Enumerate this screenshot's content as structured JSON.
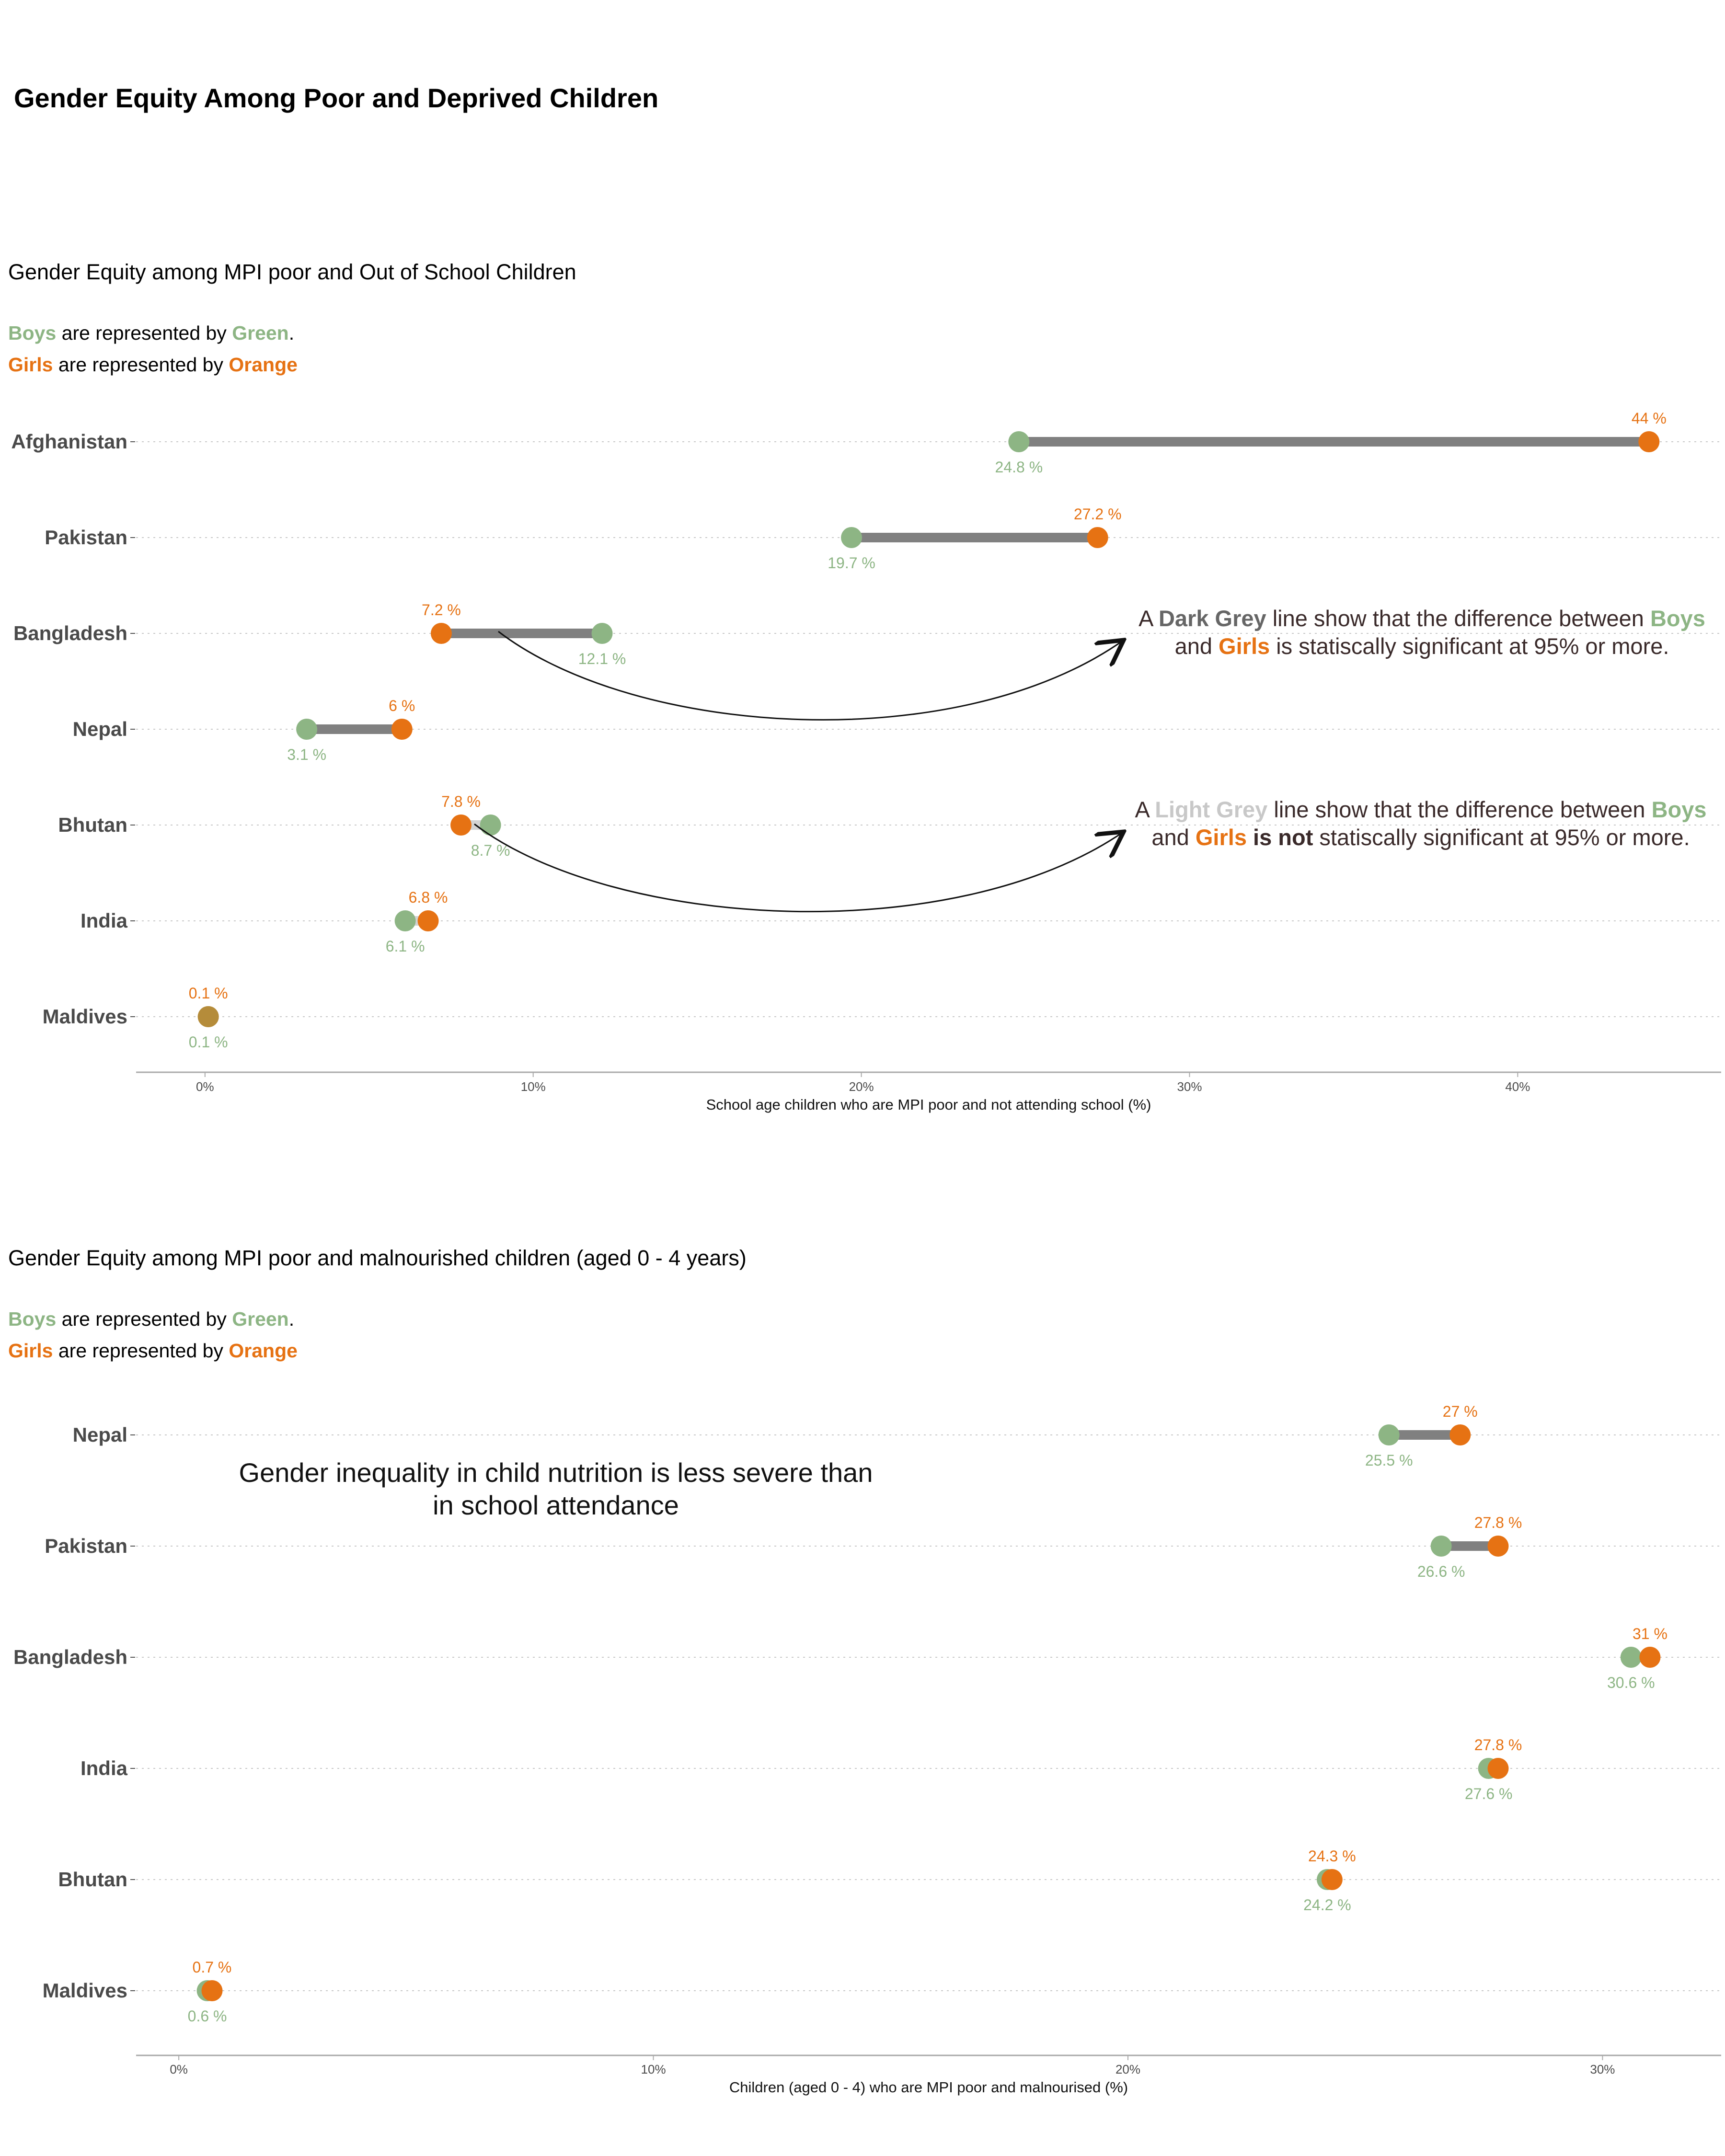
{
  "title": "Gender Equity Among Poor and Deprived Children",
  "legend": {
    "boys_word": "Boys",
    "boys_mid": " are represented by ",
    "green_word": "Green",
    "period": ".",
    "girls_word": "Girls",
    "girls_mid": " are represented by ",
    "orange_word": "Orange"
  },
  "colors": {
    "boys": "#8db584",
    "girls": "#e67213",
    "overlap": "#b58c3a",
    "significant_line": "#808080",
    "not_significant_line": "#d3d3d3",
    "gridline": "#c8c8c8"
  },
  "notes": {
    "dark": {
      "a": "A ",
      "dark_grey": "Dark Grey",
      "line1_rest": " line show that the difference between ",
      "boys": "Boys",
      "and": "and ",
      "girls": "Girls",
      "line2_rest": " is statiscally significant at 95% or more."
    },
    "light": {
      "a": "A ",
      "light_grey": "Light Grey",
      "line1_rest": " line show that the difference between ",
      "boys": "Boys",
      "and": "and ",
      "girls": "Girls",
      "is_not": " is not",
      "line2_rest": " statiscally significant at 95% or more."
    },
    "nutrition": "Gender inequality in child nutrition is less severe than in school attendance"
  },
  "chart_data": [
    {
      "type": "dumbbell",
      "title": "Gender Equity among MPI poor and Out of School Children",
      "xlabel": "School age children who are MPI poor and not attending school (%)",
      "xlim": [
        -2.1,
        46.2
      ],
      "x_ticks": [
        0,
        10,
        20,
        30,
        40
      ],
      "x_tick_labels": [
        "0%",
        "10%",
        "20%",
        "30%",
        "40%"
      ],
      "grid": "horizontal dotted",
      "categories": [
        "Afghanistan",
        "Pakistan",
        "Bangladesh",
        "Nepal",
        "Bhutan",
        "India",
        "Maldives"
      ],
      "series": [
        {
          "name": "Boys",
          "values": [
            24.8,
            19.7,
            12.1,
            3.1,
            8.7,
            6.1,
            0.1
          ]
        },
        {
          "name": "Girls",
          "values": [
            44,
            27.2,
            7.2,
            6,
            7.8,
            6.8,
            0.1
          ]
        }
      ],
      "boys_labels": [
        "24.8 %",
        "19.7 %",
        "12.1 %",
        "3.1 %",
        "8.7 %",
        "6.1 %",
        "0.1 %"
      ],
      "girls_labels": [
        "44 %",
        "27.2 %",
        "7.2 %",
        "6 %",
        "7.8 %",
        "6.8 %",
        "0.1 %"
      ],
      "significant": [
        true,
        true,
        true,
        true,
        false,
        false,
        false
      ]
    },
    {
      "type": "dumbbell",
      "title": "Gender Equity among MPI poor and malnourished children (aged 0 - 4 years)",
      "xlabel": "Children (aged 0 - 4) who are MPI poor and malnourised (%)",
      "xlim": [
        -0.9,
        32.5
      ],
      "x_ticks": [
        0,
        10,
        20,
        30
      ],
      "x_tick_labels": [
        "0%",
        "10%",
        "20%",
        "30%"
      ],
      "grid": "horizontal dotted",
      "categories": [
        "Nepal",
        "Pakistan",
        "Bangladesh",
        "India",
        "Bhutan",
        "Maldives"
      ],
      "series": [
        {
          "name": "Boys",
          "values": [
            25.5,
            26.6,
            30.6,
            27.6,
            24.2,
            0.6
          ]
        },
        {
          "name": "Girls",
          "values": [
            27,
            27.8,
            31,
            27.8,
            24.3,
            0.7
          ]
        }
      ],
      "boys_labels": [
        "25.5 %",
        "26.6 %",
        "30.6 %",
        "27.6 %",
        "24.2 %",
        "0.6 %"
      ],
      "girls_labels": [
        "27 %",
        "27.8 %",
        "31 %",
        "27.8 %",
        "24.3 %",
        "0.7 %"
      ],
      "significant": [
        true,
        true,
        false,
        false,
        false,
        false
      ]
    }
  ]
}
